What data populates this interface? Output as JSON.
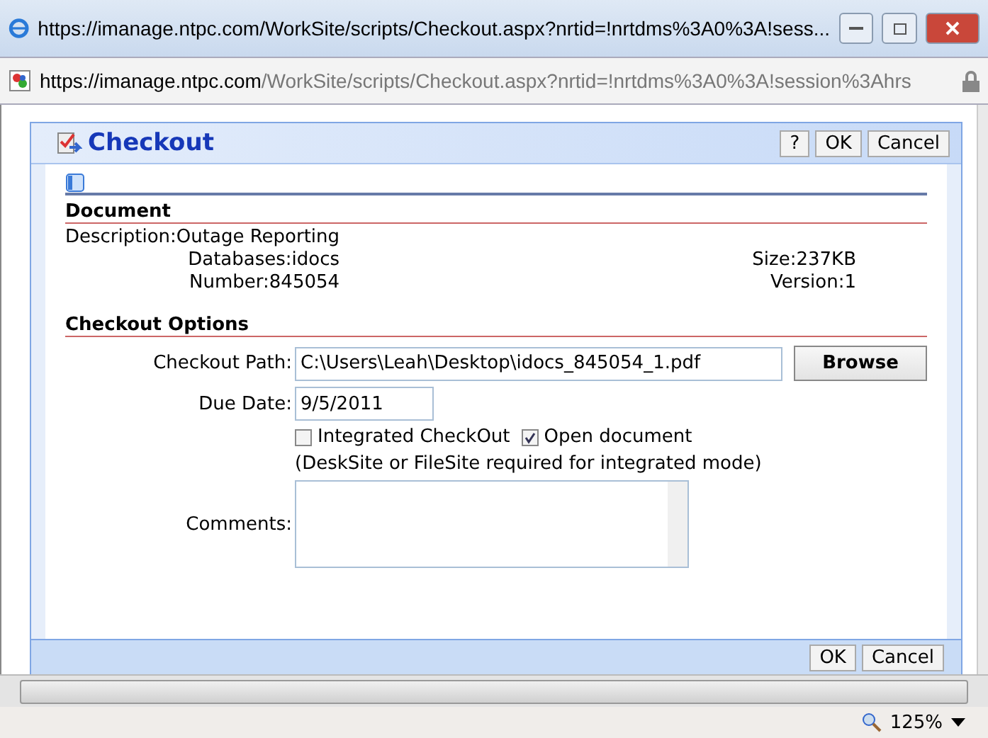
{
  "window": {
    "title": "https://imanage.ntpc.com/WorkSite/scripts/Checkout.aspx?nrtid=!nrtdms%3A0%3A!sess..."
  },
  "address_bar": {
    "host": "https://imanage.ntpc.com",
    "path": "/WorkSite/scripts/Checkout.aspx?nrtid=!nrtdms%3A0%3A!session%3Ahrs"
  },
  "dialog": {
    "title": "Checkout",
    "header_buttons": [
      "?",
      "OK",
      "Cancel"
    ],
    "document": {
      "heading": "Document",
      "left_fields": [
        {
          "label": "Description:",
          "value": "Outage Reporting"
        },
        {
          "label": "Databases:",
          "value": "idocs"
        },
        {
          "label": "Number:",
          "value": "845054"
        }
      ],
      "right_fields": [
        {
          "label": "Size:",
          "value": "237KB"
        },
        {
          "label": "Version:",
          "value": "1"
        }
      ]
    },
    "options": {
      "heading": "Checkout Options",
      "checkout_path": {
        "label": "Checkout Path:",
        "value": "C:\\Users\\Leah\\Desktop\\idocs_845054_1.pdf",
        "button": "Browse"
      },
      "due_date": {
        "label": "Due Date:",
        "value": "9/5/2011"
      },
      "checkboxes": [
        {
          "label": "Integrated CheckOut",
          "checked": false
        },
        {
          "label": "Open document",
          "checked": true
        }
      ],
      "note": "(DeskSite or FileSite required for integrated mode)",
      "comments": {
        "label": "Comments:"
      }
    },
    "footer_buttons": [
      "OK",
      "Cancel"
    ]
  },
  "status_bar": {
    "zoom": "125%"
  }
}
